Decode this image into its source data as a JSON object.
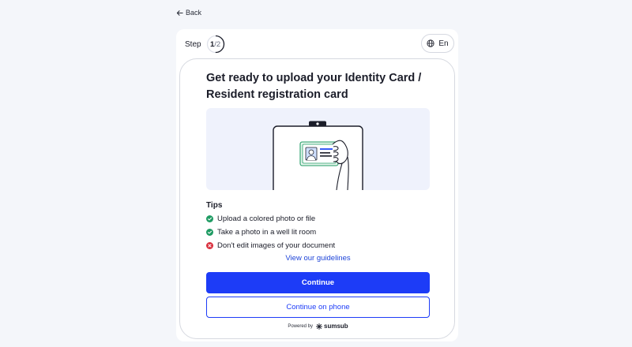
{
  "nav": {
    "back_label": "Back"
  },
  "header": {
    "step_label": "Step",
    "step_current": "1",
    "step_total": "/2",
    "language": "En",
    "step_progress": 0.5
  },
  "card": {
    "title": "Get ready to upload your Identity Card / Resident registration card",
    "tips_title": "Tips",
    "tips": [
      {
        "text": "Upload a colored photo or file",
        "status": "ok"
      },
      {
        "text": "Take a photo in a well lit room",
        "status": "ok"
      },
      {
        "text": "Don't edit images of your document",
        "status": "error"
      }
    ],
    "guidelines_link": "View our guidelines",
    "continue_label": "Continue",
    "continue_phone_label": "Continue on phone",
    "powered_by": "Powered by",
    "brand": "sumsub"
  },
  "colors": {
    "primary": "#1d3cf7",
    "ok": "#1f9b63",
    "error": "#d9303e",
    "illustration_bg": "#eff2fc"
  },
  "icons": {
    "back": "arrow-left-icon",
    "language": "globe-icon",
    "tip_ok": "check-circle-icon",
    "tip_error": "x-circle-icon",
    "brand": "sumsub-logo-icon"
  }
}
